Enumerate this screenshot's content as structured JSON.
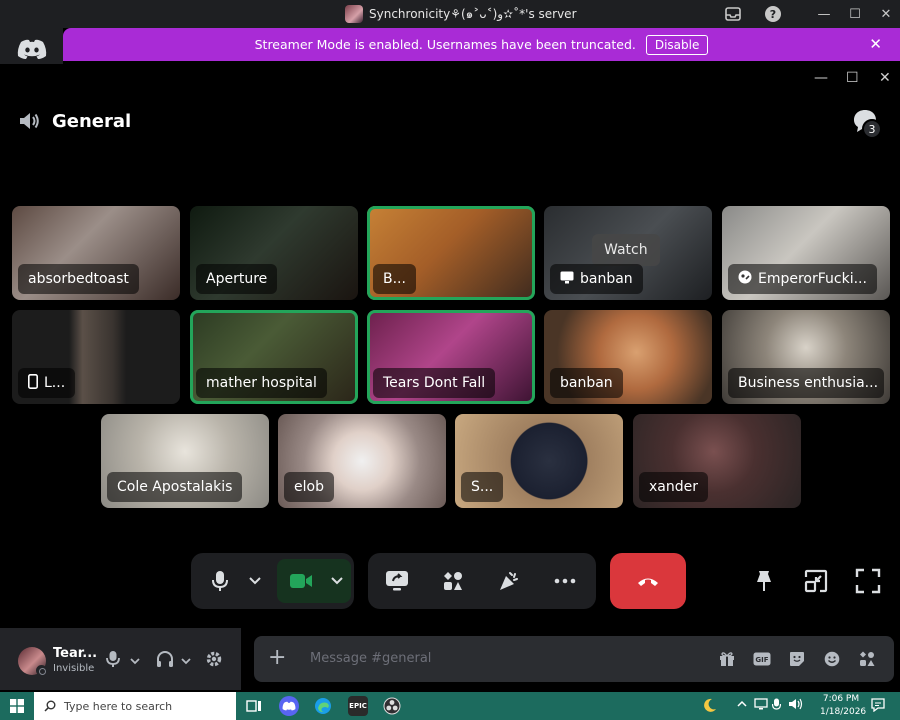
{
  "window": {
    "title": "Synchronicity⚘(๑˃ᴗ˂)ﻭ✫˚*'s server"
  },
  "banner": {
    "text": "Streamer Mode is enabled. Usernames have been truncated.",
    "disable_label": "Disable"
  },
  "channel": {
    "name": "General",
    "participant_count": "3"
  },
  "tiles": [
    {
      "name": "absorbedtoast",
      "icon": ""
    },
    {
      "name": "Aperture",
      "icon": ""
    },
    {
      "name": "B...",
      "icon": ""
    },
    {
      "name": "banban",
      "icon": "screen",
      "overlay": "Watch"
    },
    {
      "name": "EmperorFucki...",
      "icon": "activity"
    },
    {
      "name": "L...",
      "icon": "phone"
    },
    {
      "name": "mather hospital",
      "icon": ""
    },
    {
      "name": "Tears Dont Fall",
      "icon": ""
    },
    {
      "name": "banban",
      "icon": ""
    },
    {
      "name": "Business enthusia...",
      "icon": ""
    },
    {
      "name": "Cole Apostalakis",
      "icon": ""
    },
    {
      "name": "elob",
      "icon": ""
    },
    {
      "name": "S...",
      "icon": ""
    },
    {
      "name": "xander",
      "icon": ""
    }
  ],
  "user": {
    "name": "Tear...",
    "status": "Invisible"
  },
  "composer": {
    "placeholder": "Message #general"
  },
  "taskbar": {
    "search_placeholder": "Type here to search",
    "time": "7:06 PM",
    "date": "1/18/2026",
    "epic_label": "EPIC"
  },
  "colors": {
    "banner": "#a92bd6",
    "speaking": "#23a55a",
    "leave": "#da373c",
    "taskbar": "#1c6b5e"
  }
}
